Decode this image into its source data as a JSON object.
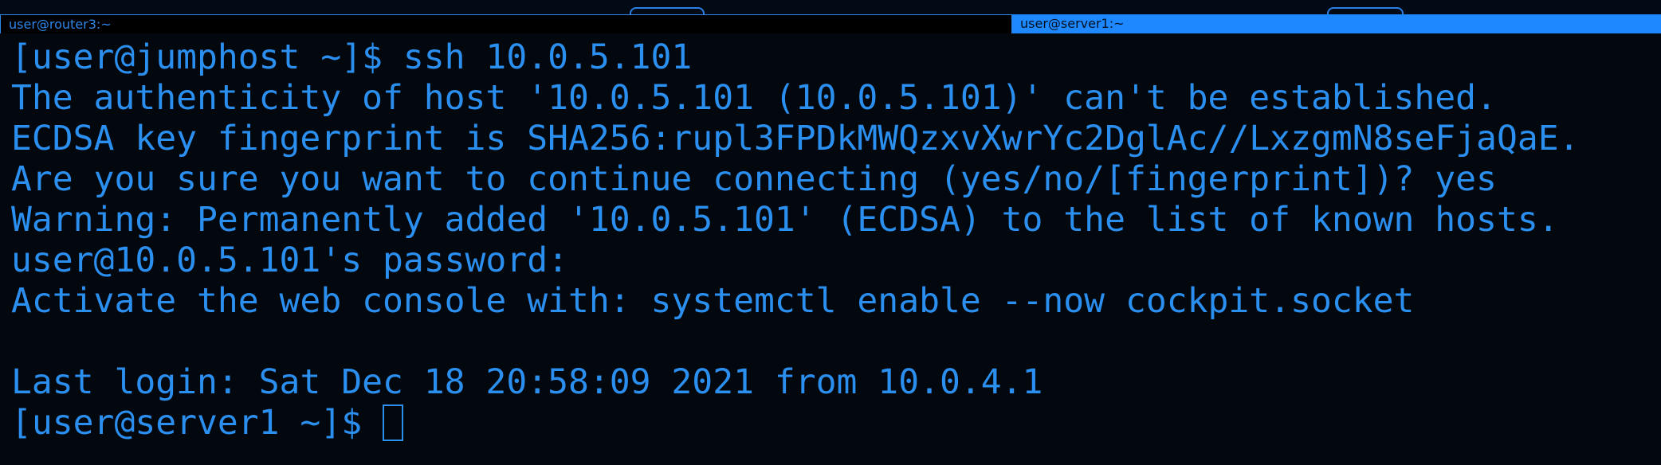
{
  "tabs": [
    {
      "label": "user@router3:~",
      "active": false
    },
    {
      "label": "user@server1:~",
      "active": true
    }
  ],
  "terminal": {
    "lines": [
      "[user@jumphost ~]$ ssh 10.0.5.101",
      "The authenticity of host '10.0.5.101 (10.0.5.101)' can't be established.",
      "ECDSA key fingerprint is SHA256:rupl3FPDkMWQzxvXwrYc2DglAc//LxzgmN8seFjaQaE.",
      "Are you sure you want to continue connecting (yes/no/[fingerprint])? yes",
      "Warning: Permanently added '10.0.5.101' (ECDSA) to the list of known hosts.",
      "user@10.0.5.101's password:",
      "Activate the web console with: systemctl enable --now cockpit.socket",
      "",
      "Last login: Sat Dec 18 20:58:09 2021 from 10.0.4.1"
    ],
    "prompt": "[user@server1 ~]$ "
  },
  "colors": {
    "background": "#03070e",
    "text": "#2b8ff0",
    "active_tab": "#1d88ff",
    "inactive_tab": "#000000"
  }
}
